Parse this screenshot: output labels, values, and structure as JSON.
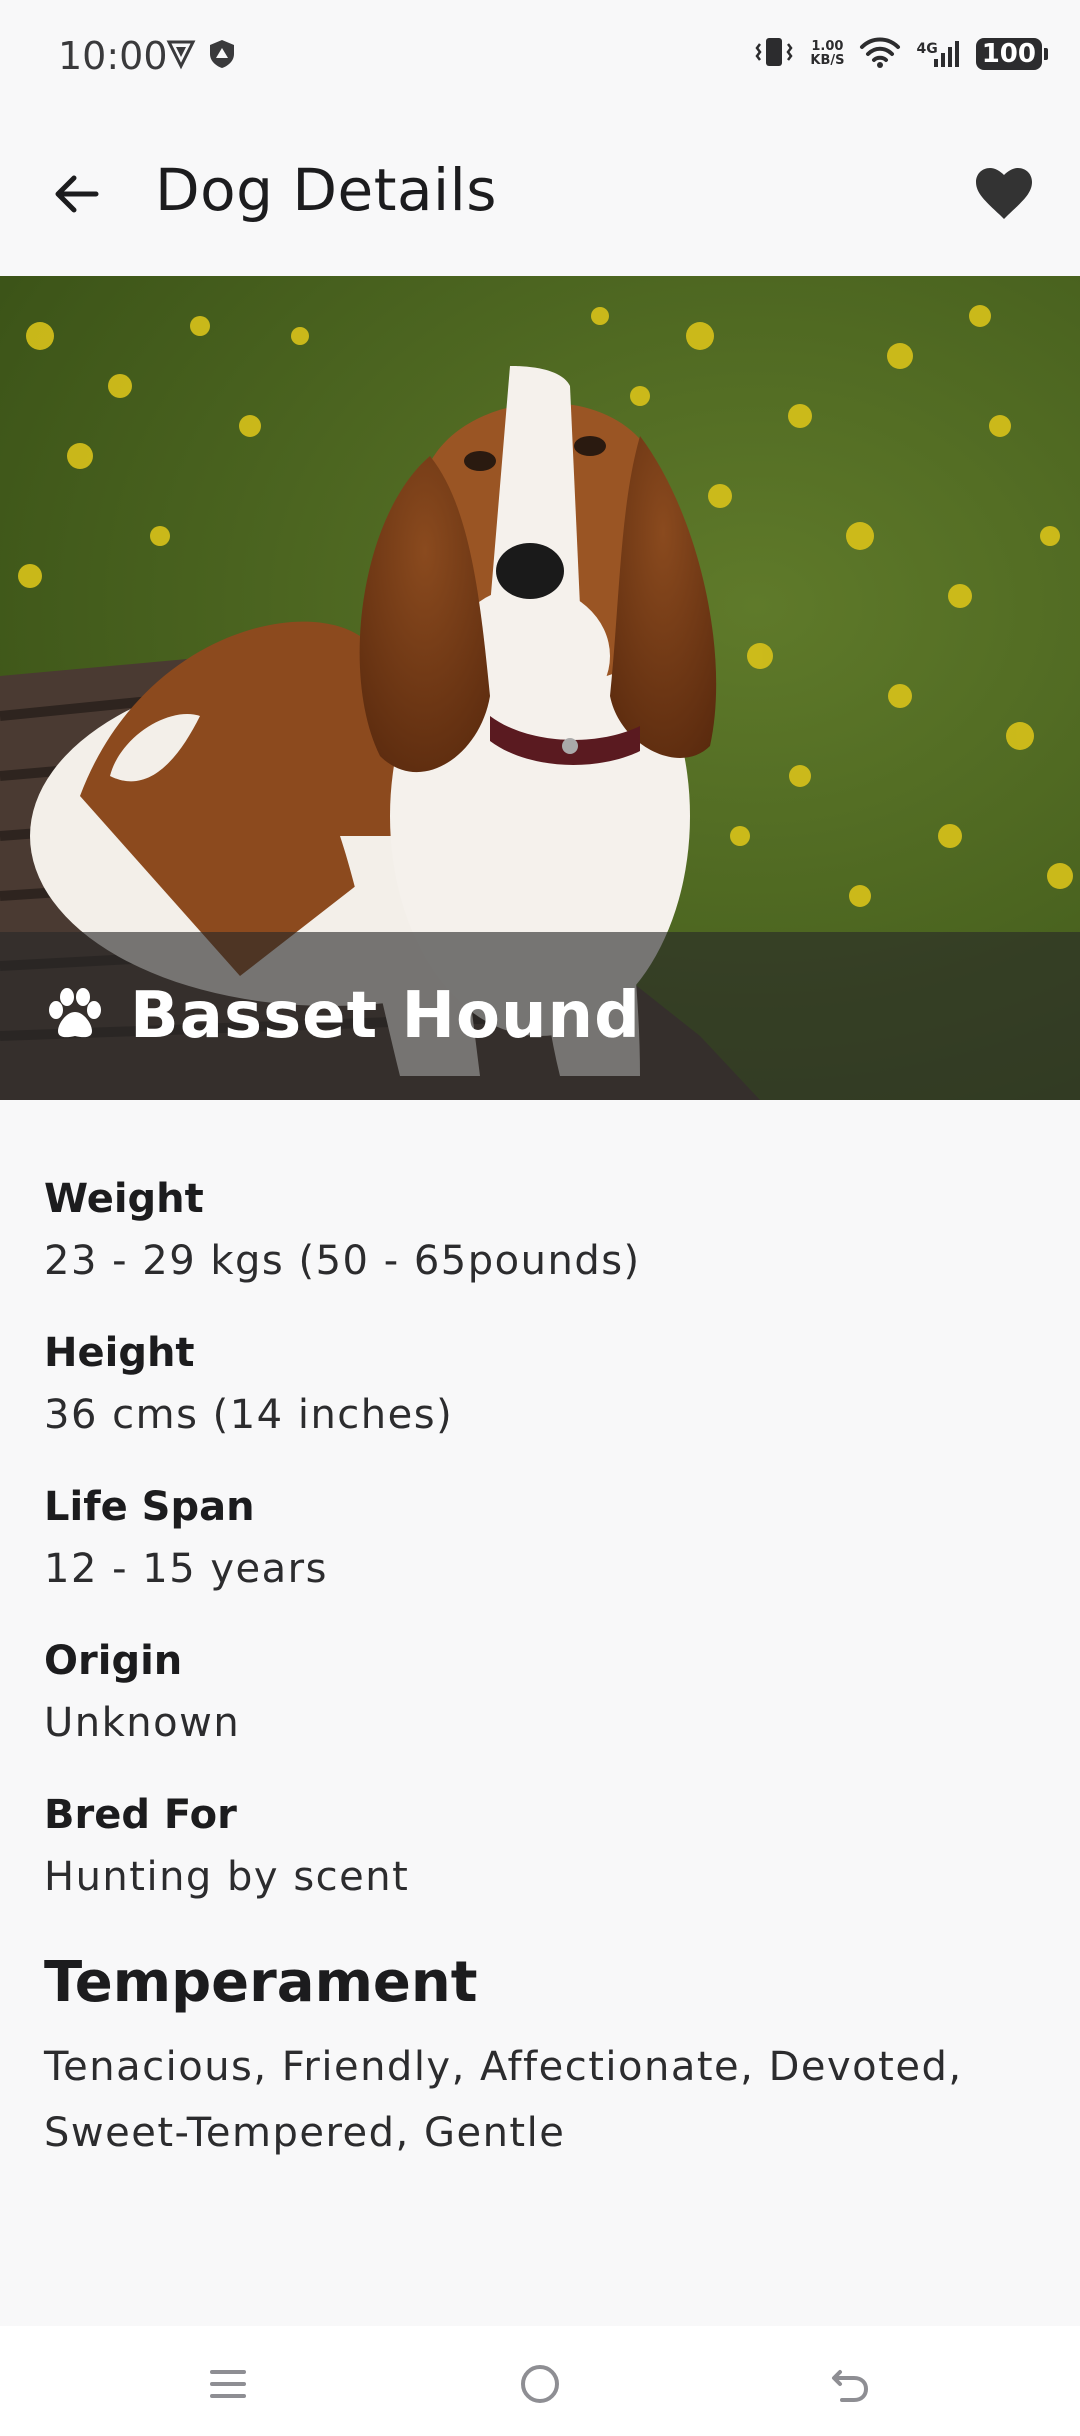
{
  "status": {
    "time": "10:00",
    "net_speed_value": "1.00",
    "net_speed_unit": "KB/S",
    "network_type": "4G",
    "battery": "100"
  },
  "app_bar": {
    "title": "Dog Details",
    "back_icon": "arrow-left-icon",
    "favorite_icon": "heart-icon"
  },
  "hero": {
    "breed_name": "Basset Hound",
    "icon": "paw-icon"
  },
  "details": {
    "fields": [
      {
        "label": "Weight",
        "value": "23 - 29 kgs (50 - 65pounds)"
      },
      {
        "label": "Height",
        "value": "36 cms (14 inches)"
      },
      {
        "label": "Life Span",
        "value": "12 - 15 years"
      },
      {
        "label": "Origin",
        "value": "Unknown"
      },
      {
        "label": "Bred For",
        "value": "Hunting by scent"
      }
    ],
    "temperament_title": "Temperament",
    "temperament_text": "Tenacious, Friendly, Affectionate, Devoted, Sweet-Tempered, Gentle"
  },
  "nav": {
    "menu_icon": "menu-icon",
    "home_icon": "home-circle-icon",
    "back_icon": "back-gesture-icon"
  },
  "colors": {
    "background": "#f8f8f9",
    "text": "#1c1c1e",
    "overlay": "#282828",
    "overlay_text": "#ffffff"
  }
}
